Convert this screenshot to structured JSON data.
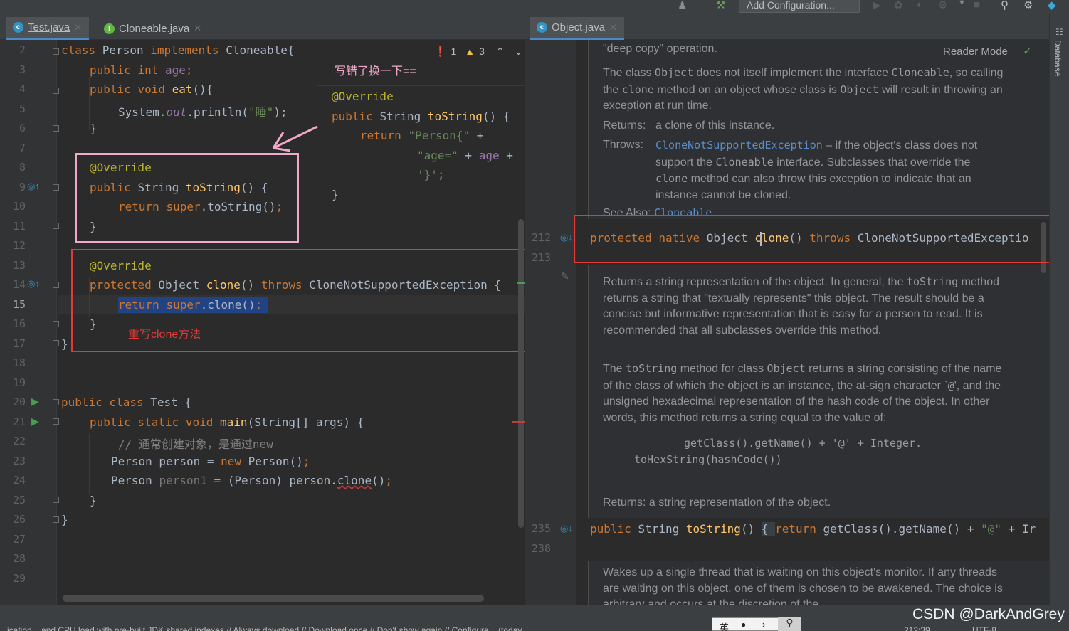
{
  "toolbar": {
    "add_config_label": "Add Configuration..."
  },
  "tabs_left": [
    {
      "label": "Test.java",
      "icon": "class-c-icon"
    },
    {
      "label": "Cloneable.java",
      "icon": "interface-i-icon"
    }
  ],
  "tabs_right": [
    {
      "label": "Object.java",
      "icon": "class-c-icon"
    }
  ],
  "inspection": {
    "errors": "1",
    "warnings": "3"
  },
  "line_numbers": [
    "2",
    "3",
    "4",
    "5",
    "6",
    "7",
    "8",
    "9",
    "10",
    "11",
    "12",
    "13",
    "14",
    "15",
    "16",
    "17",
    "18",
    "19",
    "20",
    "21",
    "22",
    "23",
    "24",
    "25",
    "26",
    "27",
    "28",
    "29"
  ],
  "code": {
    "l2": {
      "kw1": "class ",
      "name": "Person ",
      "kw2": "implements ",
      "iface": "Cloneable{"
    },
    "l3": {
      "kw": "public int ",
      "fld": "age",
      "end": ";"
    },
    "l4": {
      "kw": "public void ",
      "fn": "eat",
      "end": "(){"
    },
    "l5": {
      "a": "System.",
      "fld": "out",
      "b": ".println(",
      "str": "\"睡\"",
      "end": ");"
    },
    "l6": "}",
    "l8": "@Override",
    "l9": {
      "kw": "public ",
      "type": "String ",
      "fn": "toString",
      "end": "() {"
    },
    "l10": {
      "kw": "return ",
      "sup": "super",
      "end": ".toString()",
      "semi": ";"
    },
    "l11": "}",
    "l13": "@Override",
    "l14": {
      "kw": "protected ",
      "type": "Object ",
      "fn": "clone",
      "mid": "() ",
      "kw2": "throws ",
      "ex": "CloneNotSupportedException {"
    },
    "l15": {
      "kw": "return ",
      "sup": "super",
      "end": ".clone()",
      "semi": ";"
    },
    "l16": "}",
    "l17": "}",
    "l20": {
      "kw": "public class ",
      "name": "Test {"
    },
    "l21": {
      "kw": "public static void ",
      "fn": "main",
      "end": "(String[] args) {"
    },
    "l22": "// 通常创建对象，是通过new",
    "l23": {
      "a": "Person person = ",
      "kw": "new ",
      "b": "Person()",
      "semi": ";"
    },
    "l24": {
      "a": "Person ",
      "gr": "person1",
      "b": " = (Person) person.",
      "u": "clone",
      "c": "()",
      "semi": ";"
    },
    "l25": "}",
    "l26": "}"
  },
  "popup": {
    "l1": "@Override",
    "l2": {
      "kw": "public ",
      "type": "String ",
      "fn": "toString",
      "end": "() {"
    },
    "l3": {
      "kw": "return ",
      "str": "\"Person{\"",
      "end": " +"
    },
    "l4": {
      "str": "\"age=\"",
      "mid": " + ",
      "fld": "age",
      "end": " +"
    },
    "l5": {
      "str": "'}'",
      "semi": ";"
    },
    "l6": "}"
  },
  "annotations": {
    "wrote_wrong": "写错了换一下==",
    "override_clone": "重写clone方法"
  },
  "right": {
    "line_numbers": {
      "a": "212",
      "b": "213",
      "c": "235",
      "d": "238"
    },
    "l212": {
      "kw": "protected native ",
      "type": "Object ",
      "fn": "clone",
      "mid": "() ",
      "kw2": "throws ",
      "ex": "CloneNotSupportedExceptio"
    },
    "l235": {
      "kw": "public ",
      "type": "String ",
      "fn": "toString",
      "mid": "() ",
      "brace": "{ ",
      "kw2": "return ",
      "a": "getClass().getName() + ",
      "str": "\"@\"",
      "b": " + Ir"
    },
    "reader_mode": "Reader Mode",
    "doc1": {
      "top": "\"deep copy\" operation.",
      "p_a": "The class ",
      "p_b": "Object",
      "p_c": " does not itself implement the interface ",
      "p_d": "Cloneable",
      "p_e": ", so calling the ",
      "p_f": "clone",
      "p_g": " method on an object whose class is ",
      "p_h": "Object",
      "p_i": " will result in throwing an exception at run time.",
      "returns_label": "Returns:",
      "returns_text": "a clone of this instance.",
      "throws_label": "Throws:",
      "throws_link": "CloneNotSupportedException",
      "throws_a": " – if the object's class does not support the ",
      "throws_b": "Cloneable",
      "throws_c": " interface. Subclasses that override the ",
      "throws_d": "clone",
      "throws_e": " method can also throw this exception to indicate that an instance cannot be cloned.",
      "see_label": "See Also:",
      "see_link": "Cloneable"
    },
    "doc2": {
      "p1_a": "Returns a string representation of the object. In general, the ",
      "p1_b": "toString",
      "p1_c": " method returns a string that \"textually represents\" this object. The result should be a concise but informative representation that is easy for a person to read. It is recommended that all subclasses override this method.",
      "p2_a": "The ",
      "p2_b": "toString",
      "p2_c": " method for class ",
      "p2_d": "Object",
      "p2_e": " returns a string consisting of the name of the class of which the object is an instance, the at-sign character `",
      "p2_f": "@",
      "p2_g": "', and the unsigned hexadecimal representation of the hash code of the object. In other words, this method returns a string equal to the value of:",
      "code1": "getClass().getName() + '@' + Integer.",
      "code2": "toHexString(hashCode())",
      "returns": "Returns: a string representation of the object."
    },
    "doc3": {
      "text": "Wakes up a single thread that is waiting on this object's monitor. If any threads are waiting on this object, one of them is chosen to be awakened. The choice is arbitrary and occurs at the discretion of the"
    }
  },
  "sidebar": {
    "database": "Database"
  },
  "status": {
    "text": "...ication... and CPU load with pre-built JDK shared indexes // Always download // Download once // Don't show again // Configure... (today ...",
    "position": "212:39",
    "encoding": "UTF-8"
  },
  "ime": {
    "lang": "英"
  },
  "watermark": "CSDN @DarkAndGrey",
  "colors": {
    "accent": "#4a88c7",
    "keyword": "#cc7832",
    "annotation": "#bbb529",
    "function": "#ffc66d",
    "string": "#6a8759",
    "field": "#9876aa",
    "red_box": "#e53935",
    "pink_box": "#f0a8c8"
  }
}
